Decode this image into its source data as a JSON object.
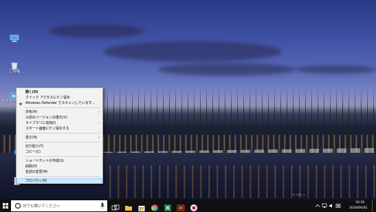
{
  "desktop": {
    "icons": [
      {
        "label": ""
      },
      {
        "label": "ごみ箱"
      },
      {
        "label": "スクリーン"
      }
    ],
    "watermark": "TI-MR-1"
  },
  "context_menu": {
    "items": [
      {
        "label": "開く(O)",
        "bold": true
      },
      {
        "label": "クイック アクセスにピン留め"
      },
      {
        "label": "Windows Defender でスキャンしています..."
      },
      {
        "sep": true
      },
      {
        "label": "共有(H)",
        "arrow": true
      },
      {
        "label": "以前のバージョンの復元(V)"
      },
      {
        "label": "ライブラリに追加(I)",
        "arrow": true
      },
      {
        "label": "スタート画面にピン留めする"
      },
      {
        "sep": true
      },
      {
        "label": "送る(N)",
        "arrow": true
      },
      {
        "sep": true
      },
      {
        "label": "切り取り(T)"
      },
      {
        "label": "コピー(C)"
      },
      {
        "sep": true
      },
      {
        "label": "ショートカットの作成(S)"
      },
      {
        "label": "削除(D)"
      },
      {
        "label": "名前の変更(M)"
      },
      {
        "sep": true
      },
      {
        "label": "プロパティ(R)",
        "highlight": true
      }
    ],
    "arrow_glyph": "›"
  },
  "taskbar": {
    "search_placeholder": "何でも聞いてください",
    "time": "16:30",
    "date": "2016/06/02",
    "accent": "#0078d7"
  }
}
